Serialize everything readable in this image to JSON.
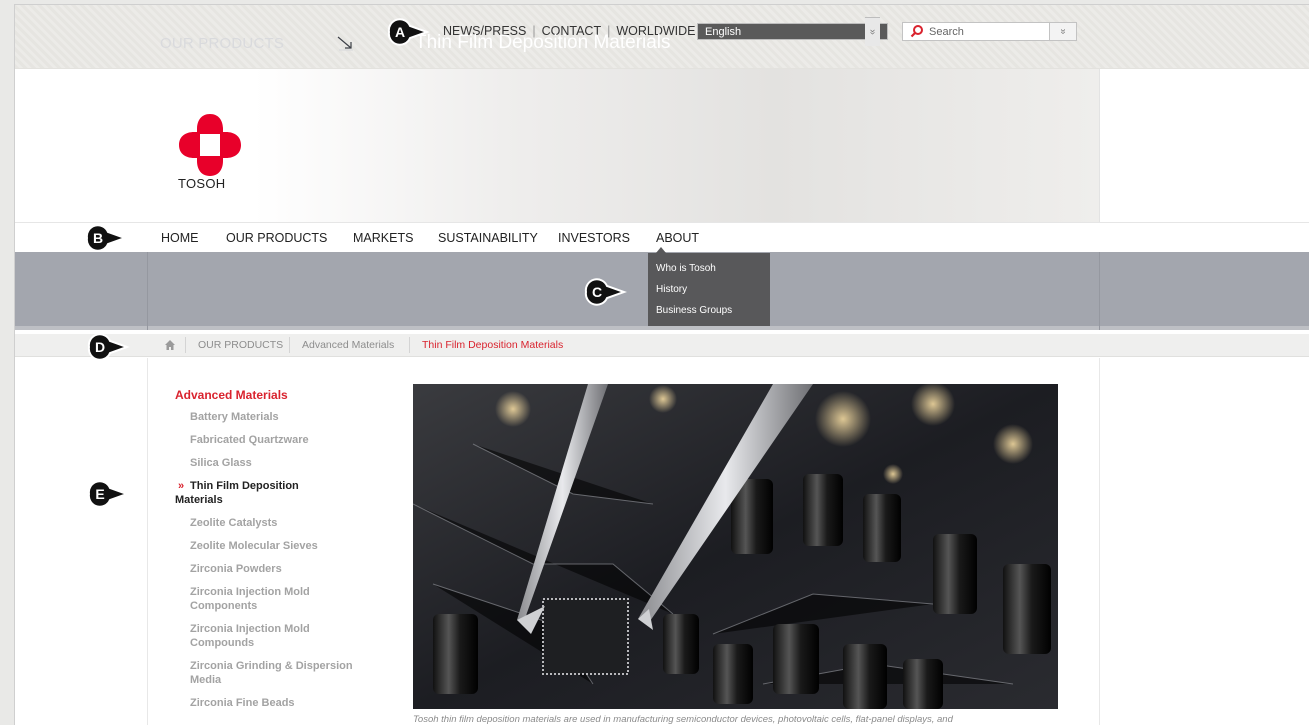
{
  "topbar": {
    "links": [
      "NEWS/PRESS",
      "CONTACT",
      "WORLDWIDE"
    ],
    "language": "English",
    "search_placeholder": "Search",
    "dropdown_glyph": "»"
  },
  "brand": {
    "logo_text": "TOSOH",
    "color": "#e8002a"
  },
  "nav": {
    "items": [
      "HOME",
      "OUR PRODUCTS",
      "MARKETS",
      "SUSTAINABILITY",
      "INVESTORS",
      "ABOUT"
    ]
  },
  "about_menu": {
    "items": [
      "Who is Tosoh",
      "History",
      "Business Groups"
    ]
  },
  "banner": {
    "section": "OUR PRODUCTS",
    "title": "Thin Film Deposition Materials"
  },
  "breadcrumb": {
    "items": [
      "OUR PRODUCTS",
      "Advanced Materials",
      "Thin Film Deposition Materials"
    ]
  },
  "sidebar": {
    "heading": "Advanced Materials",
    "items": [
      "Battery Materials",
      "Fabricated Quartzware",
      "Silica Glass",
      "Thin Film Deposition Materials",
      "Zeolite Catalysts",
      "Zeolite Molecular Sieves",
      "Zirconia Powders",
      "Zirconia Injection Mold Components",
      "Zirconia Injection Mold Compounds",
      "Zirconia Grinding & Dispersion Media",
      "Zirconia Fine Beads"
    ],
    "current_marker": "»"
  },
  "photo": {
    "caption": "Tosoh thin film deposition materials are used in manufacturing semiconductor devices, photovoltaic cells, flat-panel displays, and"
  },
  "callouts": [
    "A",
    "B",
    "C",
    "D",
    "E"
  ],
  "colors": {
    "accent_red": "#d9232e",
    "banner_gray": "#a3a6ae",
    "menu_dark": "#58585a"
  }
}
